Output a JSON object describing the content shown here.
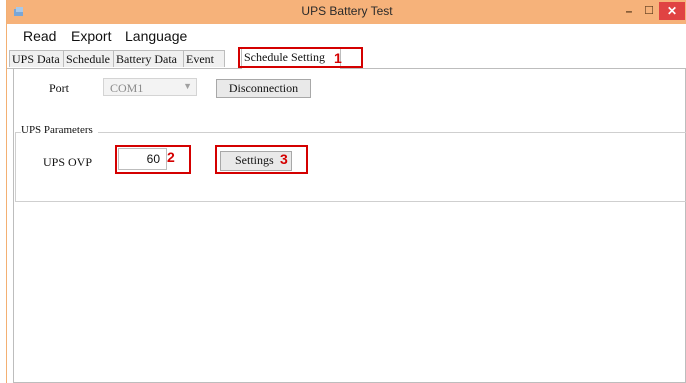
{
  "window": {
    "title": "UPS Battery Test",
    "minimize": "–",
    "maximize": "☐",
    "close": "✕"
  },
  "menu": [
    "Read",
    "Export",
    "Language"
  ],
  "tabs": [
    "UPS Data",
    "Schedule",
    "Battery Data",
    "Event",
    "Schedule Setting"
  ],
  "active_tab": "Schedule Setting",
  "port": {
    "label": "Port",
    "value": "COM1",
    "disconnect_label": "Disconnection"
  },
  "ups_parameters": {
    "legend": "UPS Parameters",
    "ovp_label": "UPS OVP",
    "ovp_value": "60",
    "settings_label": "Settings"
  },
  "annotations": [
    "1",
    "2",
    "3"
  ],
  "colors": {
    "titlebar": "#f6b27a",
    "close_button": "#e04343",
    "annotation": "#d40000"
  }
}
